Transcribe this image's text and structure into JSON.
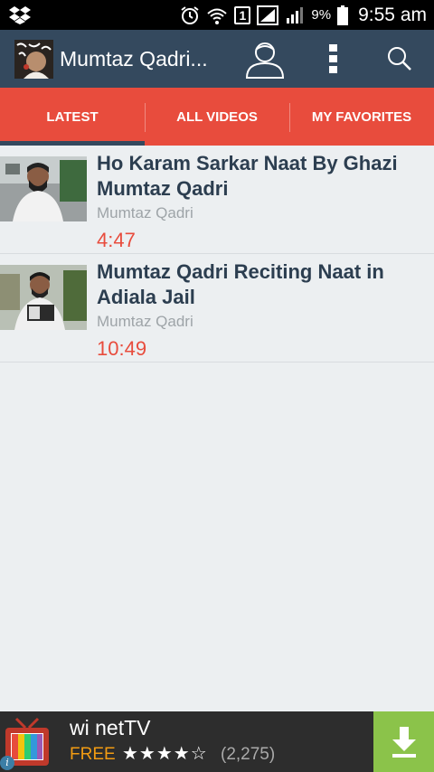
{
  "status_bar": {
    "battery_percent": "9%",
    "time": "9:55 am",
    "sim_label": "1"
  },
  "app_bar": {
    "title": "Mumtaz Qadri..."
  },
  "tabs": [
    {
      "label": "LATEST",
      "active": true
    },
    {
      "label": "ALL VIDEOS",
      "active": false
    },
    {
      "label": "MY FAVORITES",
      "active": false
    }
  ],
  "videos": [
    {
      "title": "Ho Karam Sarkar Naat By Ghazi Mumtaz Qadri",
      "channel": "Mumtaz Qadri",
      "duration": "4:47"
    },
    {
      "title": "Mumtaz Qadri Reciting Naat in Adiala Jail",
      "channel": "Mumtaz Qadri",
      "duration": "10:49"
    }
  ],
  "ad": {
    "app_name": "wi netTV",
    "price": "FREE",
    "stars": "★★★★☆",
    "rating_value": 4,
    "review_count": "(2,275)"
  },
  "colors": {
    "app_bar": "#34495e",
    "tab_bar": "#e84c3d",
    "duration": "#e84c3d",
    "background": "#eceff1",
    "install_button": "#8bc34a",
    "ad_price": "#f39c12"
  }
}
